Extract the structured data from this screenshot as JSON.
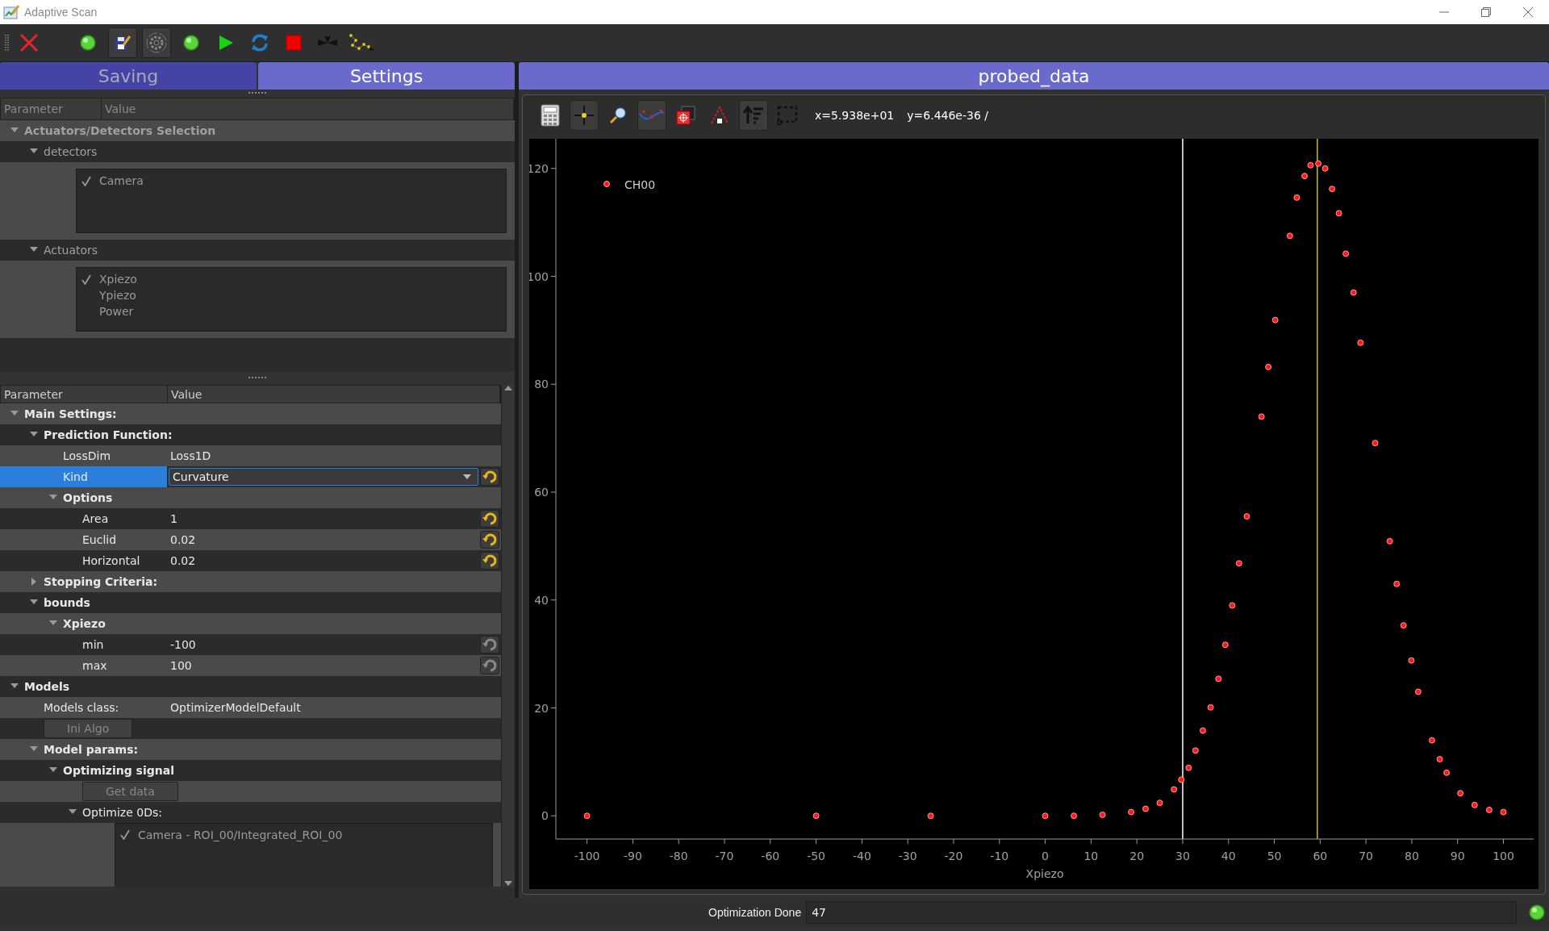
{
  "window": {
    "title": "Adaptive Scan"
  },
  "tabs": [
    {
      "label": "Saving",
      "selected": false
    },
    {
      "label": "Settings",
      "selected": true
    }
  ],
  "selection_tree": {
    "columns": [
      "Parameter",
      "Value"
    ],
    "disabled": true,
    "rows": [
      {
        "kind": "section",
        "label": "Actuators/Detectors Selection",
        "expanded": true,
        "selected": false,
        "children": [
          {
            "kind": "group",
            "label": "detectors",
            "expanded": true,
            "selected": false,
            "children": [
              {
                "kind": "checklist",
                "disabled": true,
                "items": [
                  {
                    "label": "Camera",
                    "checked": true
                  }
                ]
              }
            ]
          },
          {
            "kind": "group",
            "label": "Actuators",
            "expanded": true,
            "selected": false,
            "children": [
              {
                "kind": "checklist",
                "disabled": true,
                "items": [
                  {
                    "label": "Xpiezo",
                    "checked": true
                  },
                  {
                    "label": "Ypiezo",
                    "checked": false
                  },
                  {
                    "label": "Power",
                    "checked": false
                  }
                ]
              }
            ]
          }
        ]
      }
    ]
  },
  "settings_tree": {
    "columns": [
      "Parameter",
      "Value"
    ],
    "disabled": false,
    "rows": [
      {
        "kind": "section",
        "label": "Main Settings:",
        "expanded": true,
        "selected": false,
        "children": [
          {
            "kind": "section",
            "label": "Prediction Function:",
            "expanded": true,
            "selected": false,
            "children": [
              {
                "kind": "param",
                "label": "LossDim",
                "value": "Loss1D",
                "selected": false
              },
              {
                "kind": "combo",
                "label": "Kind",
                "value": "Curvature",
                "selected": true,
                "reset_enabled": true
              },
              {
                "kind": "section",
                "label": "Options",
                "expanded": true,
                "selected": false,
                "children": [
                  {
                    "kind": "param",
                    "label": "Area",
                    "value": "1",
                    "selected": false,
                    "reset_enabled": true
                  },
                  {
                    "kind": "param",
                    "label": "Euclid",
                    "value": "0.02",
                    "selected": false,
                    "reset_enabled": true
                  },
                  {
                    "kind": "param",
                    "label": "Horizontal",
                    "value": "0.02",
                    "selected": false,
                    "reset_enabled": true
                  }
                ]
              }
            ]
          },
          {
            "kind": "section",
            "label": "Stopping Criteria:",
            "expanded": false,
            "selected": false
          },
          {
            "kind": "section",
            "label": "bounds",
            "expanded": true,
            "selected": false,
            "children": [
              {
                "kind": "section",
                "label": "Xpiezo",
                "expanded": true,
                "selected": false,
                "children": [
                  {
                    "kind": "param",
                    "label": "min",
                    "value": "-100",
                    "selected": false,
                    "reset_enabled": false
                  },
                  {
                    "kind": "param",
                    "label": "max",
                    "value": "100",
                    "selected": false,
                    "reset_enabled": false
                  }
                ]
              }
            ]
          }
        ]
      },
      {
        "kind": "section",
        "label": "Models",
        "expanded": true,
        "selected": false,
        "children": [
          {
            "kind": "param",
            "label": "Models class:",
            "value": "OptimizerModelDefault",
            "selected": false
          },
          {
            "kind": "button",
            "label": "Ini Algo",
            "disabled": true
          },
          {
            "kind": "section",
            "label": "Model params:",
            "expanded": true,
            "selected": false,
            "children": [
              {
                "kind": "section",
                "label": "Optimizing signal",
                "expanded": true,
                "selected": false,
                "children": [
                  {
                    "kind": "button",
                    "label": "Get data",
                    "disabled": true
                  },
                  {
                    "kind": "group",
                    "label": "Optimize 0Ds:",
                    "expanded": true,
                    "selected": false,
                    "children": [
                      {
                        "kind": "checklist",
                        "disabled": true,
                        "items": [
                          {
                            "label": "Camera - ROI_00/Integrated_ROI_00",
                            "checked": true
                          }
                        ]
                      }
                    ]
                  }
                ]
              }
            ]
          }
        ]
      }
    ]
  },
  "plot": {
    "title": "probed_data",
    "cursor_x": "x=5.938e+01",
    "cursor_y": "y=6.446e-36 /",
    "chart_data": {
      "type": "scatter",
      "xlabel": "Xpiezo",
      "x": [
        -100,
        -50,
        -25,
        0,
        6.25,
        12.5,
        18.75,
        21.9,
        25,
        28.1,
        29.7,
        31.3,
        32.8,
        34.4,
        36.1,
        37.8,
        39.3,
        40.8,
        42.3,
        44,
        47.2,
        48.7,
        50.2,
        53.4,
        54.9,
        56.6,
        57.9,
        59.6,
        61.1,
        62.6,
        64.1,
        65.6,
        67.3,
        68.8,
        72,
        75.2,
        76.7,
        78.2,
        79.9,
        81.4,
        84.4,
        86.1,
        87.6,
        90.6,
        93.7,
        96.9,
        100
      ],
      "series": [
        {
          "name": "CH00",
          "color": "#ff1a1a",
          "values": [
            0,
            0,
            0,
            0,
            0,
            0.2,
            0.7,
            1.3,
            2.4,
            4.9,
            6.7,
            8.9,
            12.1,
            15.8,
            20.1,
            25.4,
            31.7,
            39,
            46.8,
            55.5,
            74,
            83.2,
            91.9,
            107.5,
            114.6,
            118.6,
            120.6,
            120.9,
            120,
            116.2,
            111.7,
            104.2,
            97,
            87.7,
            69.1,
            50.9,
            43,
            35.3,
            28.8,
            23,
            14,
            10.5,
            8,
            4.2,
            2,
            1.1,
            0.7
          ]
        }
      ],
      "xlim": [
        -106.8,
        106.6
      ],
      "ylim": [
        -4.3,
        125.5
      ],
      "xticks": [
        -100,
        -90,
        -80,
        -70,
        -60,
        -50,
        -40,
        -30,
        -20,
        -10,
        0,
        10,
        20,
        30,
        40,
        50,
        60,
        70,
        80,
        90,
        100
      ],
      "yticks": [
        0,
        20,
        40,
        60,
        80,
        100,
        120
      ],
      "ref_lines": [
        {
          "axis": "x",
          "value": 30,
          "color": "#ffffff"
        },
        {
          "axis": "x",
          "value": 59.38,
          "color": "#c8c020"
        }
      ]
    }
  },
  "status_bar": {
    "message": "Optimization Done",
    "value": "47",
    "led_on": true
  }
}
